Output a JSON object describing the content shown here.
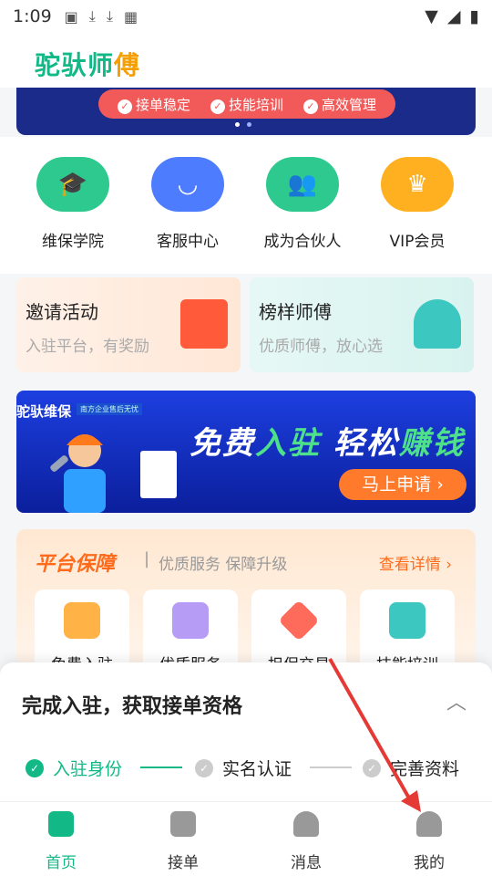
{
  "status_bar": {
    "time": "1:09"
  },
  "header": {
    "logo_main": "驼驮师",
    "logo_accent": "傅"
  },
  "banner_top": {
    "pills": [
      "接单稳定",
      "技能培训",
      "高效管理"
    ]
  },
  "quick_actions": [
    {
      "label": "维保学院",
      "icon": "graduation-cap-icon",
      "color": "#2ec98f"
    },
    {
      "label": "客服中心",
      "icon": "chat-bubble-icon",
      "color": "#4d7cfe"
    },
    {
      "label": "成为合伙人",
      "icon": "users-icon",
      "color": "#2ec98f"
    },
    {
      "label": "VIP会员",
      "icon": "crown-icon",
      "color": "#ffb020"
    }
  ],
  "cards": [
    {
      "title": "邀请活动",
      "subtitle": "入驻平台，有奖励",
      "icon": "gift-icon"
    },
    {
      "title": "榜样师傅",
      "subtitle": "优质师傅，放心选",
      "icon": "trophy-icon"
    }
  ],
  "promo": {
    "brand": "驼驮维保",
    "tag": "南方企业售后无忧",
    "headline_1": "免费",
    "headline_2": "入驻",
    "headline_3": "轻松",
    "headline_4": "赚钱",
    "cta": "马上申请 ›"
  },
  "guarantee": {
    "title": "平台保障",
    "subtitle": "优质服务 保障升级",
    "more": "查看详情 ›",
    "items": [
      "免费入驻",
      "优质服务",
      "担保交易",
      "技能培训"
    ]
  },
  "sheet": {
    "title": "完成入驻，获取接单资格",
    "steps": [
      "入驻身份",
      "实名认证",
      "完善资料"
    ]
  },
  "tabbar": [
    "首页",
    "接单",
    "消息",
    "我的"
  ],
  "colors": {
    "brand": "#12b886",
    "accent": "#ff6b1a",
    "arrow": "#e53935"
  }
}
